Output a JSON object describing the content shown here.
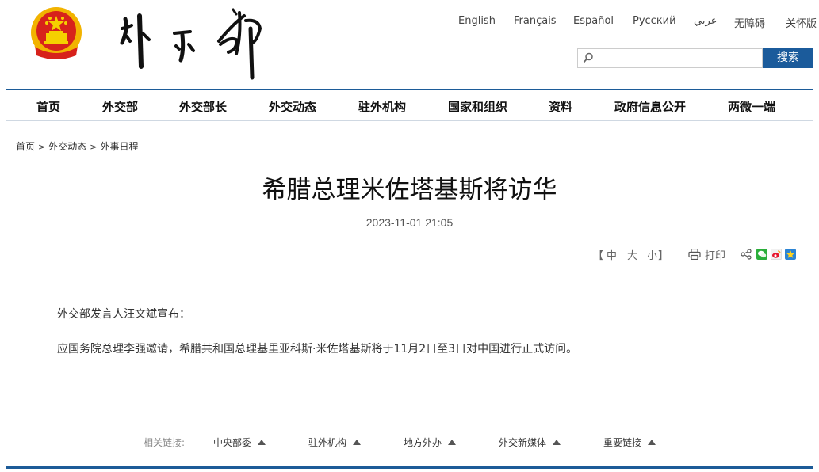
{
  "header": {
    "languages": [
      "English",
      "Français",
      "Español",
      "Русский",
      "عربي",
      "无障碍",
      "关怀版"
    ],
    "search": {
      "placeholder": "",
      "button_label": "搜索"
    }
  },
  "nav": {
    "items": [
      "首页",
      "外交部",
      "外交部长",
      "外交动态",
      "驻外机构",
      "国家和组织",
      "资料",
      "政府信息公开",
      "两微一端"
    ]
  },
  "breadcrumb": [
    "首页",
    "外交动态",
    "外事日程"
  ],
  "article": {
    "title": "希腊总理米佐塔基斯将访华",
    "date": "2023-11-01 21:05",
    "font_size": {
      "open": "【",
      "large": "中",
      "medium": "大",
      "small": "小",
      "close": "】"
    },
    "print_label": "打印",
    "paragraphs": [
      "外交部发言人汪文斌宣布：",
      "应国务院总理李强邀请，希腊共和国总理基里亚科斯·米佐塔基斯将于11月2日至3日对中国进行正式访问。"
    ]
  },
  "footer": {
    "related_label": "相关链接:",
    "links": [
      "中央部委",
      "驻外机构",
      "地方外办",
      "外交新媒体",
      "重要链接"
    ]
  },
  "colors": {
    "brand_blue": "#1b5b9b",
    "emblem_red": "#d7221b",
    "emblem_gold": "#f2c200"
  }
}
